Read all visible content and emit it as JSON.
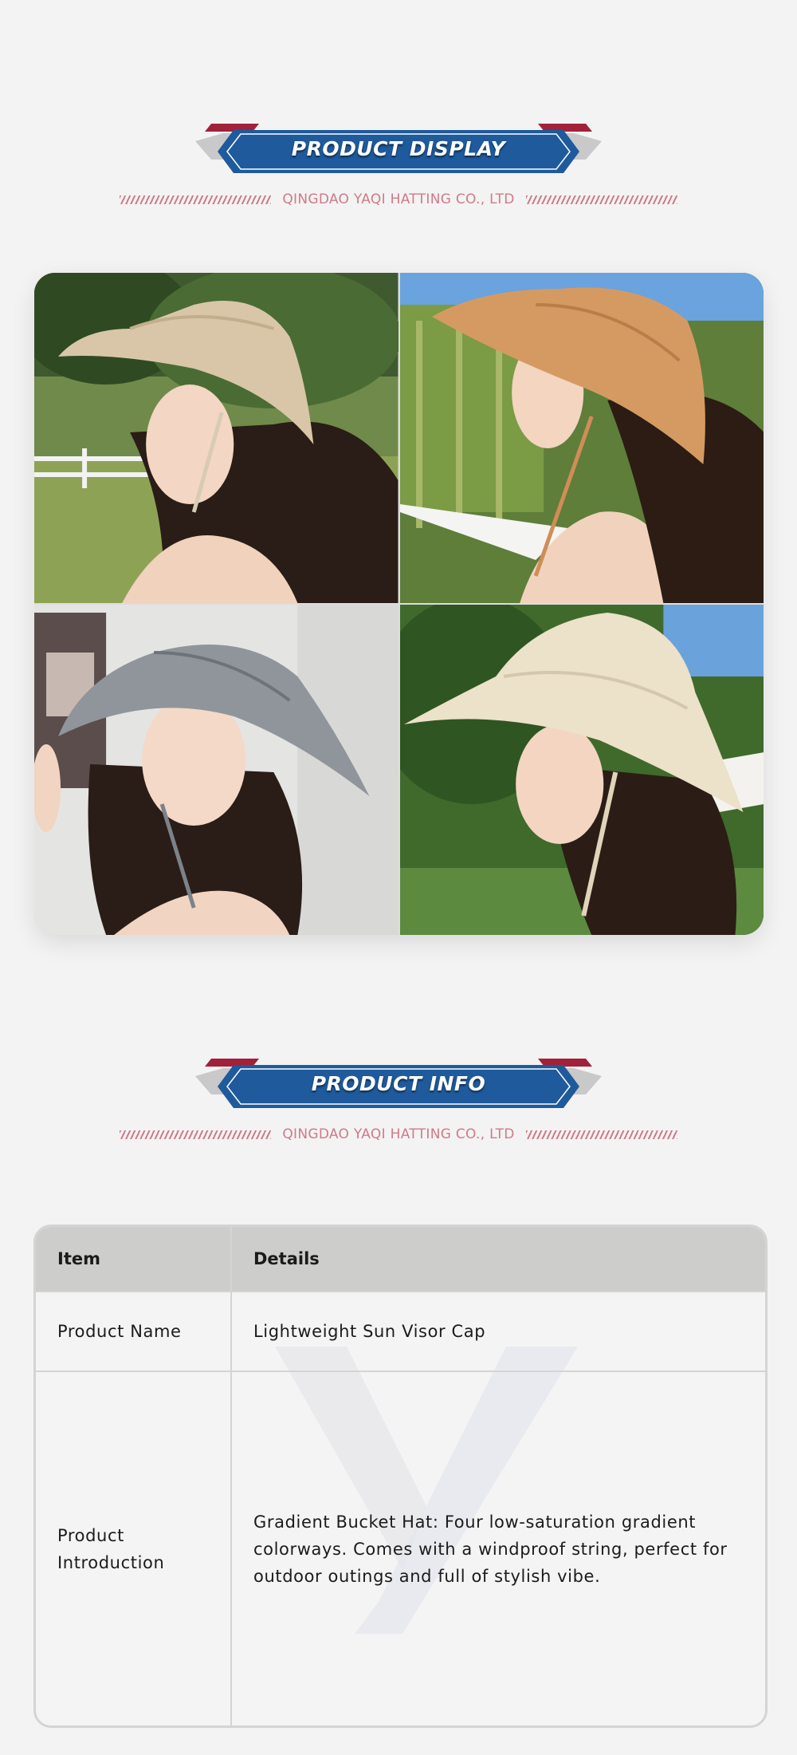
{
  "sections": [
    {
      "title": "PRODUCT DISPLAY",
      "subtitle": "QINGDAO YAQI HATTING CO., LTD"
    },
    {
      "title": "PRODUCT INFO",
      "subtitle": "QINGDAO YAQI HATTING CO., LTD"
    }
  ],
  "gallery": {
    "photos": [
      {
        "hat_color": "#d9c6a8"
      },
      {
        "hat_color": "#d59a62"
      },
      {
        "hat_color": "#8f959b"
      },
      {
        "hat_color": "#ece1c9"
      }
    ]
  },
  "info_table": {
    "headers": [
      "Item",
      "Details"
    ],
    "rows": [
      {
        "item": "Product Name",
        "details": "Lightweight Sun Visor Cap"
      },
      {
        "item": "Product Introduction",
        "details": "Gradient Bucket Hat: Four low-saturation gradient colorways. Comes with a windproof string, perfect for outdoor outings and full of stylish vibe."
      }
    ]
  },
  "colors": {
    "banner_blue": "#1e5a9c",
    "banner_red": "#a3203a",
    "accent_pink": "#cf7a8a",
    "background": "#f3f3f3"
  }
}
